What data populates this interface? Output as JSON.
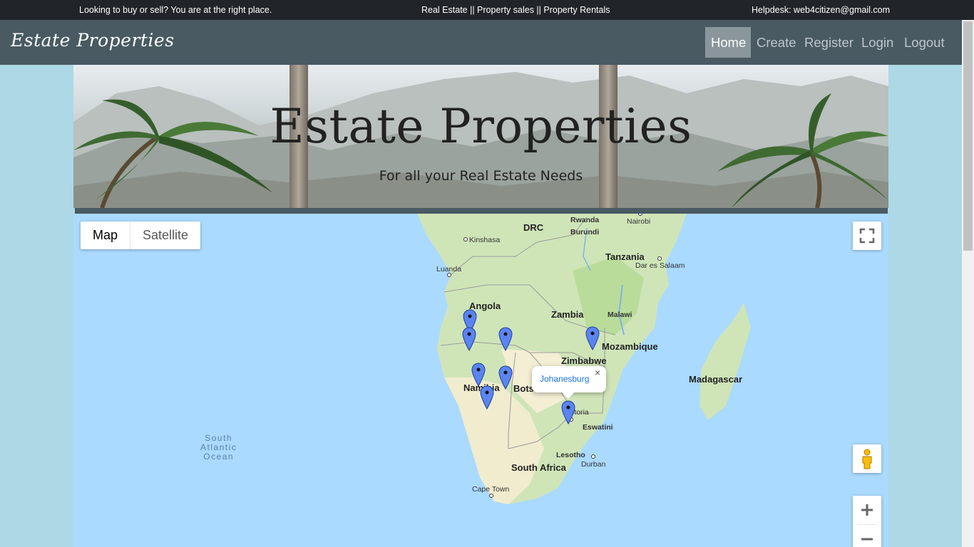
{
  "topbar": {
    "left": "Looking to buy or sell? You are at the right place.",
    "center": "Real Estate || Property sales || Property Rentals",
    "right": "Helpdesk: web4citizen@gmail.com"
  },
  "navbar": {
    "brand": "Estate Properties",
    "items": [
      {
        "label": "Home",
        "active": true
      },
      {
        "label": "Create",
        "active": false
      },
      {
        "label": "Register",
        "active": false
      },
      {
        "label": "Login",
        "active": false
      },
      {
        "label": "Logout",
        "active": false
      }
    ]
  },
  "hero": {
    "title": "Estate Properties",
    "subtitle": "For all your Real Estate Needs"
  },
  "map": {
    "type_control": {
      "map": "Map",
      "satellite": "Satellite",
      "selected": "Map"
    },
    "labels": {
      "drc": "DRC",
      "rwanda": "Rwanda",
      "burundi": "Burundi",
      "nairobi": "Nairobi",
      "kinshasa": "Kinshasa",
      "tanzania": "Tanzania",
      "dar_es_salaam": "Dar es Salaam",
      "luanda": "Luanda",
      "angola": "Angola",
      "zambia": "Zambia",
      "malawi": "Malawi",
      "mozambique": "Mozambique",
      "zimbabwe": "Zimbabwe",
      "madagascar": "Madagascar",
      "namibia": "Namibia",
      "botswana": "Bots",
      "pretoria": "Pretoria",
      "eswatini": "Eswatini",
      "lesotho": "Lesotho",
      "durban": "Durban",
      "south_africa": "South Africa",
      "cape_town": "Cape Town",
      "ocean_line1": "South",
      "ocean_line2": "Atlantic",
      "ocean_line3": "Ocean"
    },
    "info_window": {
      "text": "Johanesburg",
      "close": "×"
    },
    "marker_count": 8,
    "colors": {
      "water": "#aadaff",
      "land": "#cfe5b8",
      "marker": "#5b84f0"
    }
  },
  "icons": {
    "fullscreen": "fullscreen-icon",
    "pegman": "pegman-icon",
    "zoom_in": "zoom-in-icon",
    "zoom_out": "zoom-out-icon",
    "close": "close-icon",
    "marker": "map-marker-icon"
  }
}
